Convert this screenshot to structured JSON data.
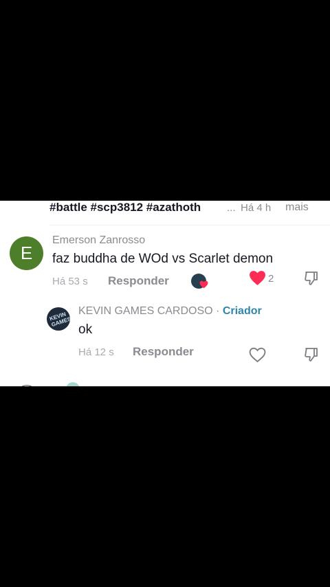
{
  "caption": {
    "text": "#battle #scp3812 #azathoth",
    "ellipsis": "...",
    "time": "Há 4 h",
    "more_label": "mais"
  },
  "comments": [
    {
      "avatar_letter": "E",
      "avatar_color": "#4d7f2a",
      "author": "Emerson Zanrosso",
      "text": "faz buddha de WOd vs Scarlet demon",
      "time": "Há 53 s",
      "reply_label": "Responder",
      "like_count": "2",
      "liked": true
    },
    {
      "avatar_text": "KEVIN GAMES",
      "author": "KEVIN GAMES CARDOSO",
      "separator": " · ",
      "author_badge": "Criador",
      "text": "ok",
      "time": "Há 12 s",
      "reply_label": "Responder",
      "liked": false
    }
  ],
  "colors": {
    "like_red": "#fe2c55",
    "creator_teal": "#2e86a8",
    "muted_text": "#8a8b91"
  },
  "icons": [
    "heart-icon",
    "dislike-icon"
  ]
}
